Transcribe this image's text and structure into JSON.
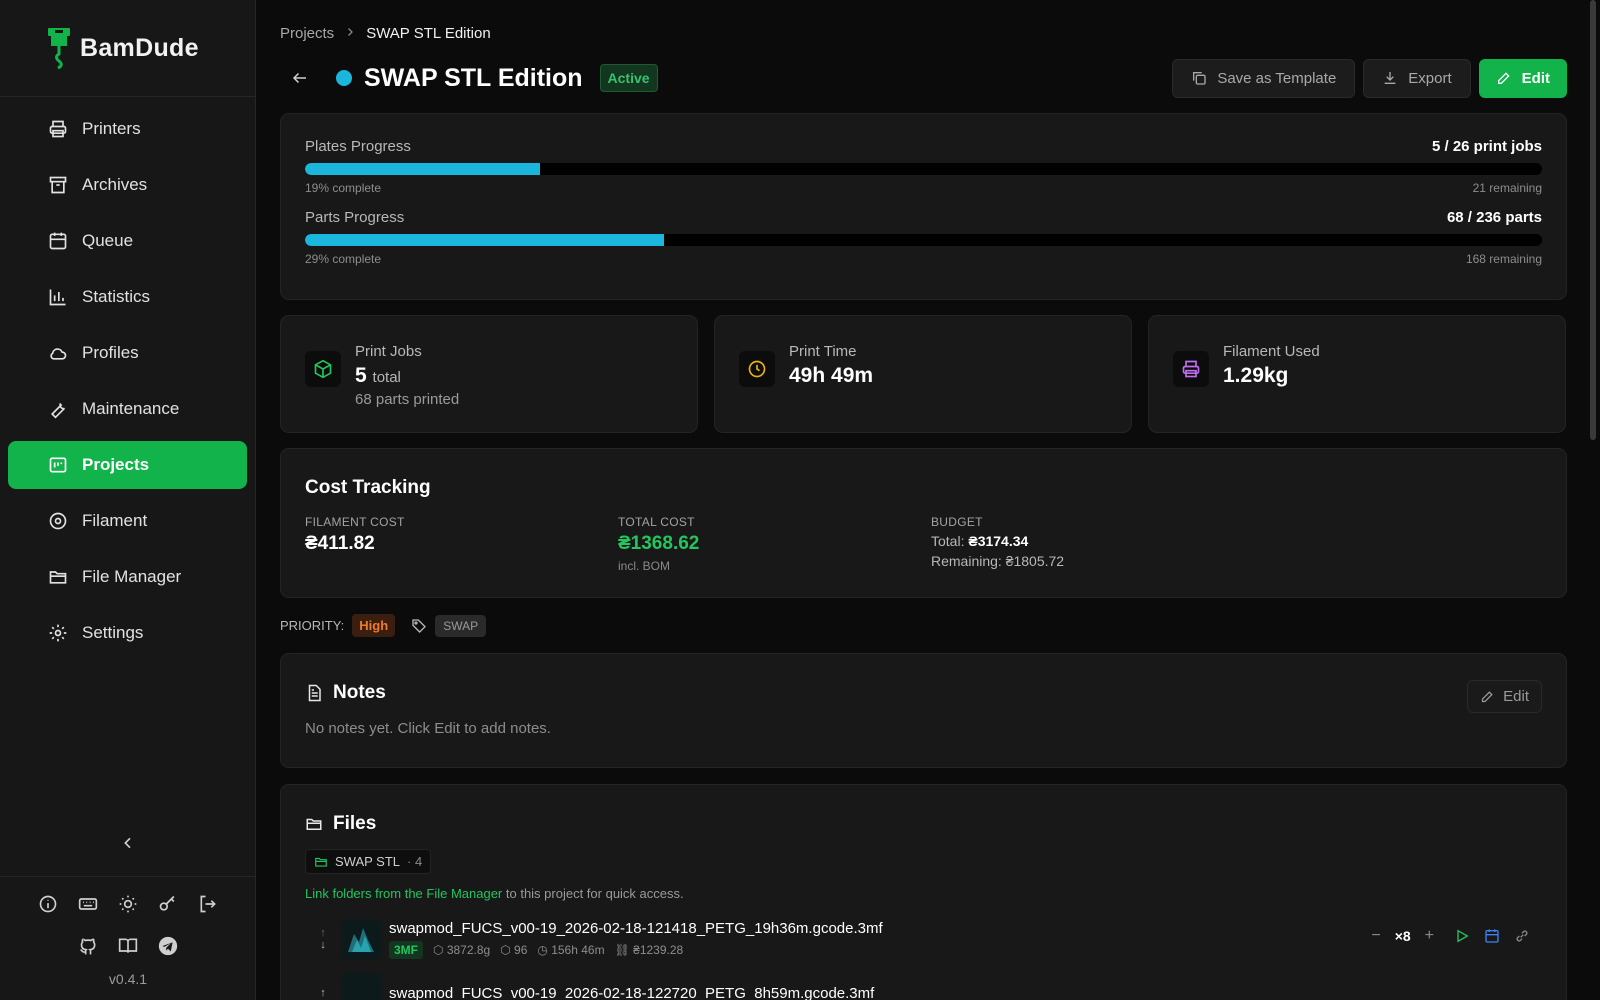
{
  "app": {
    "name": "BamDude",
    "version": "v0.4.1"
  },
  "sidebar": {
    "items": [
      {
        "label": "Printers",
        "icon": "printer-icon"
      },
      {
        "label": "Archives",
        "icon": "archive-icon"
      },
      {
        "label": "Queue",
        "icon": "calendar-icon"
      },
      {
        "label": "Statistics",
        "icon": "bar-chart-icon"
      },
      {
        "label": "Profiles",
        "icon": "cloud-icon"
      },
      {
        "label": "Maintenance",
        "icon": "wrench-icon"
      },
      {
        "label": "Projects",
        "icon": "projects-icon",
        "active": true
      },
      {
        "label": "Filament",
        "icon": "spool-icon"
      },
      {
        "label": "File Manager",
        "icon": "folder-open-icon"
      },
      {
        "label": "Settings",
        "icon": "gear-icon"
      }
    ]
  },
  "breadcrumb": {
    "parent": "Projects",
    "current": "SWAP STL Edition"
  },
  "header": {
    "title": "SWAP STL Edition",
    "status": "Active",
    "status_color": "#1bb6dc",
    "save_template_label": "Save as Template",
    "export_label": "Export",
    "edit_label": "Edit"
  },
  "progress": {
    "plates": {
      "label": "Plates Progress",
      "count": "5 / 26 print jobs",
      "complete": "19% complete",
      "remaining": "21 remaining",
      "fraction": 0.19
    },
    "parts": {
      "label": "Parts Progress",
      "count": "68 / 236 parts",
      "complete": "29% complete",
      "remaining": "168 remaining",
      "fraction": 0.29
    }
  },
  "stats": {
    "jobs": {
      "label": "Print Jobs",
      "value": "5",
      "unit": "total",
      "sub": "68 parts printed"
    },
    "time": {
      "label": "Print Time",
      "value": "49h 49m"
    },
    "filament": {
      "label": "Filament Used",
      "value": "1.29kg"
    }
  },
  "cost": {
    "title": "Cost Tracking",
    "filament_label": "FILAMENT COST",
    "filament_value": "₴411.82",
    "total_label": "TOTAL COST",
    "total_value": "₴1368.62",
    "total_sub": "incl. BOM",
    "budget_label": "BUDGET",
    "budget_total_label": "Total:",
    "budget_total_value": "₴3174.34",
    "budget_remaining": "Remaining: ₴1805.72"
  },
  "meta": {
    "priority_label": "PRIORITY:",
    "priority": "High",
    "tag": "SWAP"
  },
  "notes": {
    "title": "Notes",
    "edit_label": "Edit",
    "empty": "No notes yet. Click Edit to add notes."
  },
  "files": {
    "title": "Files",
    "folder": {
      "name": "SWAP STL",
      "count": "· 4"
    },
    "hint_link": "Link folders from the File Manager",
    "hint_rest": " to this project for quick access.",
    "items": [
      {
        "name": "swapmod_FUCS_v00-19_2026-02-18-121418_PETG_19h36m.gcode.3mf",
        "type": "3MF",
        "weight": "3872.8g",
        "parts": "96",
        "time": "156h 46m",
        "cost": "₴1239.28",
        "qty": "×8"
      },
      {
        "name": "swapmod_FUCS_v00-19_2026-02-18-122720_PETG_8h59m.gcode.3mf"
      }
    ]
  },
  "colors": {
    "accent": "#12b34a",
    "progress": "#1bb6dc",
    "priority": "#f07a2c"
  }
}
